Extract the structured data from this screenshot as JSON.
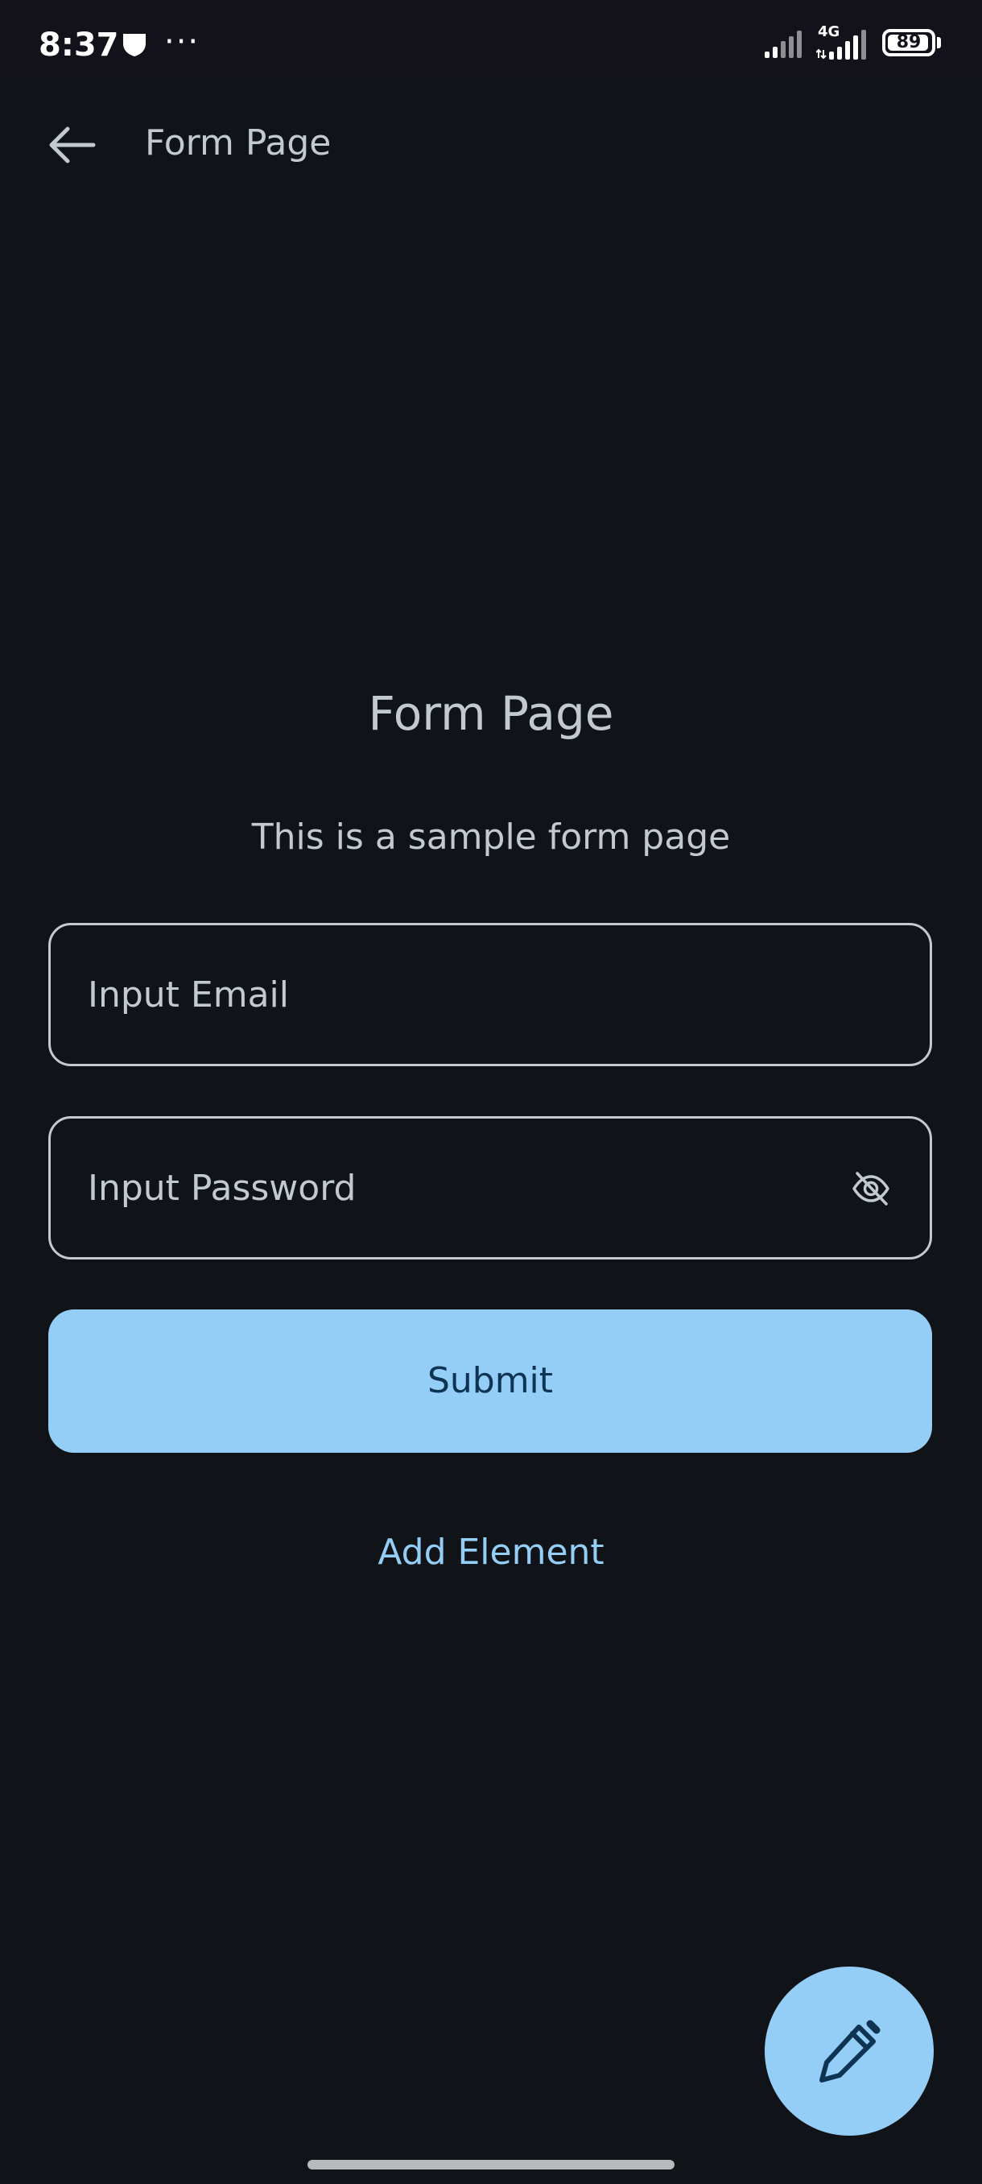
{
  "status_bar": {
    "time": "8:37",
    "network": "4G",
    "battery": "89",
    "battery_level": 0.89,
    "icons": [
      "shield-icon",
      "more-dots-icon",
      "signal-icon",
      "signal-4g-icon",
      "battery-icon"
    ]
  },
  "app_bar": {
    "title": "Form Page",
    "back_icon": "arrow-left-icon"
  },
  "page": {
    "title": "Form Page",
    "subtitle": "This is a sample form page"
  },
  "form": {
    "email_placeholder": "Input Email",
    "password_placeholder": "Input Password",
    "password_visibility_icon": "eye-off-icon",
    "submit_label": "Submit",
    "add_element_label": "Add Element"
  },
  "fab": {
    "icon": "pencil-icon"
  },
  "colors": {
    "background": "#101418",
    "status_bar": "#13111a",
    "text": "#c3c9d1",
    "accent": "#94cdf6",
    "on_accent": "#0f3352"
  }
}
